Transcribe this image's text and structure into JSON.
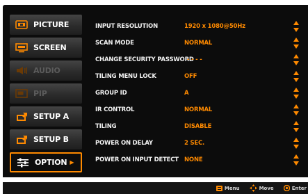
{
  "sidebar": {
    "items": [
      {
        "label": "PICTURE",
        "icon": "picture-icon",
        "state": "normal"
      },
      {
        "label": "SCREEN",
        "icon": "screen-icon",
        "state": "normal"
      },
      {
        "label": "AUDIO",
        "icon": "audio-icon",
        "state": "disabled"
      },
      {
        "label": "PIP",
        "icon": "pip-icon",
        "state": "disabled"
      },
      {
        "label": "SETUP A",
        "icon": "setup-a-icon",
        "state": "normal"
      },
      {
        "label": "SETUP B",
        "icon": "setup-b-icon",
        "state": "normal"
      },
      {
        "label": "OPTION",
        "icon": "option-icon",
        "state": "active"
      }
    ]
  },
  "settings": [
    {
      "name": "INPUT RESOLUTION",
      "value": "1920 x 1080@50Hz"
    },
    {
      "name": "SCAN MODE",
      "value": "NORMAL"
    },
    {
      "name": "CHANGE SECURITY PASSWORD",
      "value": "- - - -"
    },
    {
      "name": "TILING MENU LOCK",
      "value": "OFF"
    },
    {
      "name": "GROUP ID",
      "value": "A"
    },
    {
      "name": "IR CONTROL",
      "value": "NORMAL"
    },
    {
      "name": "TILING",
      "value": "DISABLE"
    },
    {
      "name": "POWER ON DELAY",
      "value": "2 SEC."
    },
    {
      "name": "POWER ON INPUT DETECT",
      "value": "NONE"
    }
  ],
  "footer": {
    "menu_label": "Menu",
    "move_label": "Move",
    "enter_label": "Enter"
  },
  "colors": {
    "accent": "#ff8a00",
    "background": "#0c0c0c",
    "text": "#f2f2f2",
    "disabled_text": "#5b5b5b"
  }
}
